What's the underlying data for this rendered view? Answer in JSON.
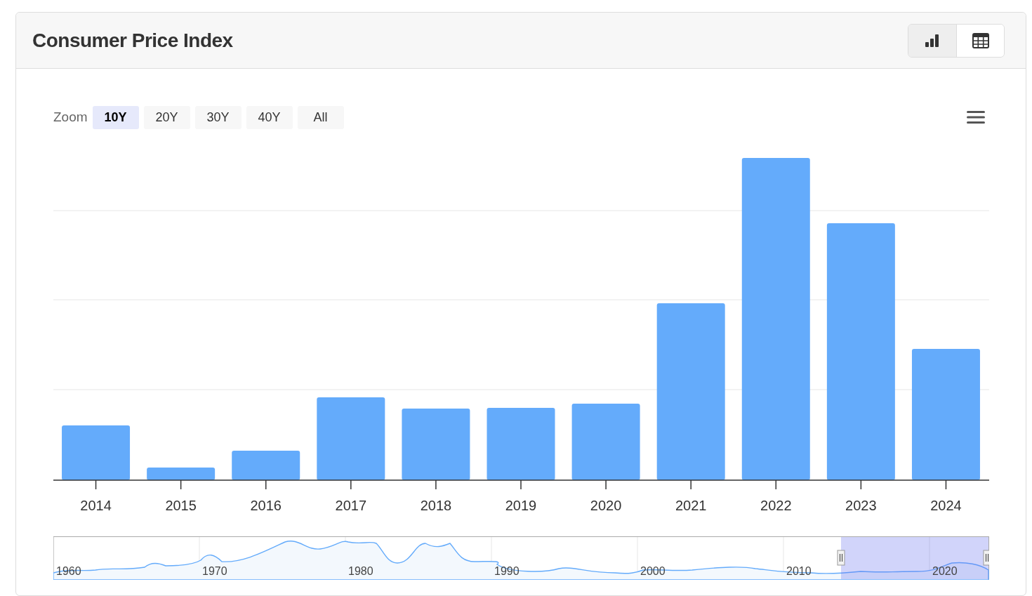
{
  "card": {
    "title": "Consumer Price Index",
    "view_toggles": [
      {
        "kind": "chart",
        "selected": true
      },
      {
        "kind": "table",
        "selected": false
      }
    ]
  },
  "zoom": {
    "label": "Zoom",
    "options": [
      {
        "label": "10Y",
        "selected": true
      },
      {
        "label": "20Y",
        "selected": false
      },
      {
        "label": "30Y",
        "selected": false
      },
      {
        "label": "40Y",
        "selected": false
      },
      {
        "label": "All",
        "selected": false
      }
    ]
  },
  "chart": {
    "x_labels": [
      "2014",
      "2015",
      "2016",
      "2017",
      "2018",
      "2019",
      "2020",
      "2021",
      "2022",
      "2023",
      "2024"
    ]
  },
  "navigator": {
    "labels": [
      "1960",
      "1970",
      "1980",
      "1990",
      "2000",
      "2010",
      "2020"
    ]
  }
}
